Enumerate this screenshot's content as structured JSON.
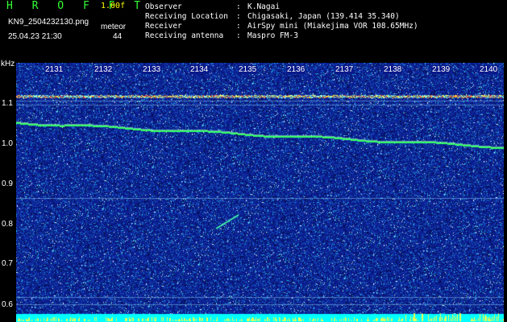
{
  "header": {
    "app_title": "H R O F F T",
    "version": "1.00f",
    "filename": "KN9_2504232130.png",
    "mode": "meteor",
    "datetime": "25.04.23 21:30",
    "count": "44"
  },
  "info": [
    {
      "key": "Observer",
      "value": "K.Nagai"
    },
    {
      "key": "Receiving Location",
      "value": "Chigasaki, Japan (139.414 35.340)"
    },
    {
      "key": "Receiver",
      "value": "AirSpy mini (Miakejima VOR 108.65MHz)"
    },
    {
      "key": "Receiving antenna",
      "value": "Maspro FM-3"
    }
  ],
  "axes": {
    "y_unit": "kHz",
    "y_ticks": [
      "1.1",
      "1.0",
      "0.9",
      "0.8",
      "0.7",
      "0.6"
    ],
    "x_ticks": [
      "2131",
      "2132",
      "2133",
      "2134",
      "2135",
      "2136",
      "2137",
      "2138",
      "2139",
      "2140"
    ]
  },
  "colors": {
    "background": "#000000",
    "spectrogram_base": "#0a1a8a",
    "noise_hot": "#00ffff",
    "signal": "#33ff66",
    "baseline": "#00ffff"
  }
}
